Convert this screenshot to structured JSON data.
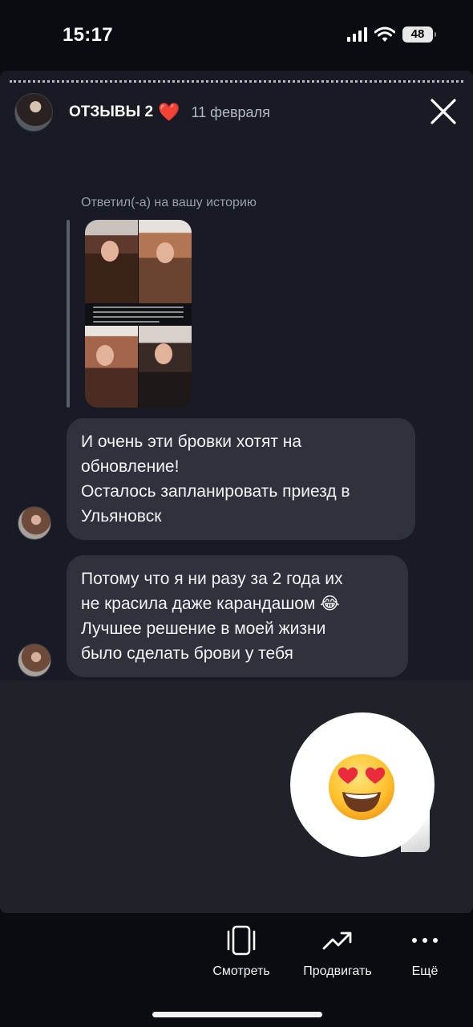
{
  "status_bar": {
    "time": "15:17",
    "battery": "48"
  },
  "story": {
    "title": "ОТЗЫВЫ 2",
    "title_emoji": "❤️",
    "date": "11 февраля"
  },
  "reply": {
    "caption": "Ответил(-а) на вашу историю"
  },
  "messages": [
    {
      "lines": [
        "И очень эти бровки хотят на",
        "обновление!",
        "Осталось запланировать приезд в",
        "Ульяновск"
      ]
    },
    {
      "lines": [
        "Потому что я ни разу за 2 года их",
        "не красила даже карандашом 😂",
        "Лучшее решение в моей жизни",
        "было сделать брови у тебя"
      ]
    }
  ],
  "reaction": {
    "emoji": "heart-eyes-icon"
  },
  "toolbar": {
    "view_label": "Смотреть",
    "promote_label": "Продвигать",
    "more_label": "Ещё"
  },
  "colors": {
    "background": "#0b0c11",
    "card": "#181b24",
    "bubble": "#2f323c",
    "reaction_area": "#202229",
    "heart": "#ef2a35"
  }
}
